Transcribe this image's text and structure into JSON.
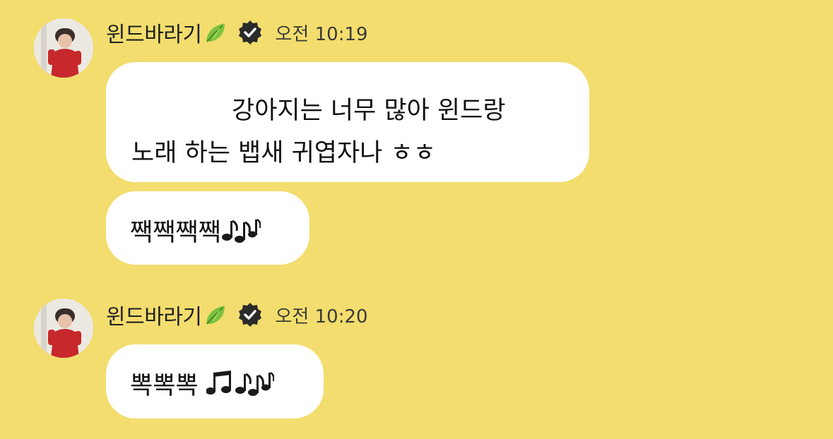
{
  "messages": [
    {
      "sender": "윈드바라기",
      "leaf_icon": "leaf-emoji-icon",
      "verified_icon": "verified-badge-icon",
      "time": "오전 10:19",
      "bubbles": [
        {
          "lines": [
            "강아지는 너무 많아 윈드랑",
            "노래 하는 뱁새 귀엽자나 ㅎㅎ"
          ]
        },
        {
          "text": "짹짹짹짹",
          "icons": [
            "double-music-note-icon"
          ]
        }
      ]
    },
    {
      "sender": "윈드바라기",
      "leaf_icon": "leaf-emoji-icon",
      "verified_icon": "verified-badge-icon",
      "time": "오전 10:20",
      "bubbles": [
        {
          "text": "뽁뽁뽁",
          "icons": [
            "beamed-music-notes-icon",
            "double-music-note-icon"
          ]
        }
      ]
    }
  ],
  "colors": {
    "background": "#f3dd6e",
    "bubble": "#ffffff",
    "leaf": "#7cc23f",
    "verified_badge": "#2b2b2b"
  }
}
